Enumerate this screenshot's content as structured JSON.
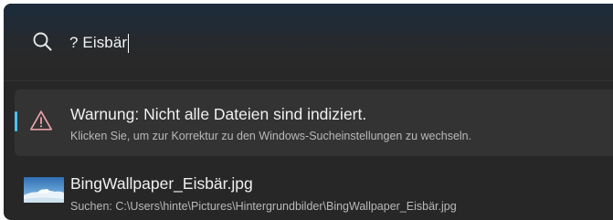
{
  "search": {
    "query": "? Eisbär"
  },
  "results": [
    {
      "type": "warning",
      "icon": "warning-icon",
      "title": "Warnung: Nicht alle Dateien sind indiziert.",
      "subtitle": "Klicken Sie, um zur Korrektur zu den Windows-Sucheinstellungen zu wechseln.",
      "selected": true
    },
    {
      "type": "file",
      "icon": "image-thumbnail",
      "title": "BingWallpaper_Eisbär.jpg",
      "subtitle": "Suchen: C:\\Users\\hinte\\Pictures\\Hintergrundbilder\\BingWallpaper_Eisbär.jpg",
      "selected": false
    }
  ],
  "colors": {
    "background": "#272727",
    "selected_background": "#333333",
    "accent": "#4cc2ff",
    "warning_icon": "#e8a0a8",
    "text_primary": "#f0f0f0",
    "text_secondary": "#b9b9b9"
  }
}
